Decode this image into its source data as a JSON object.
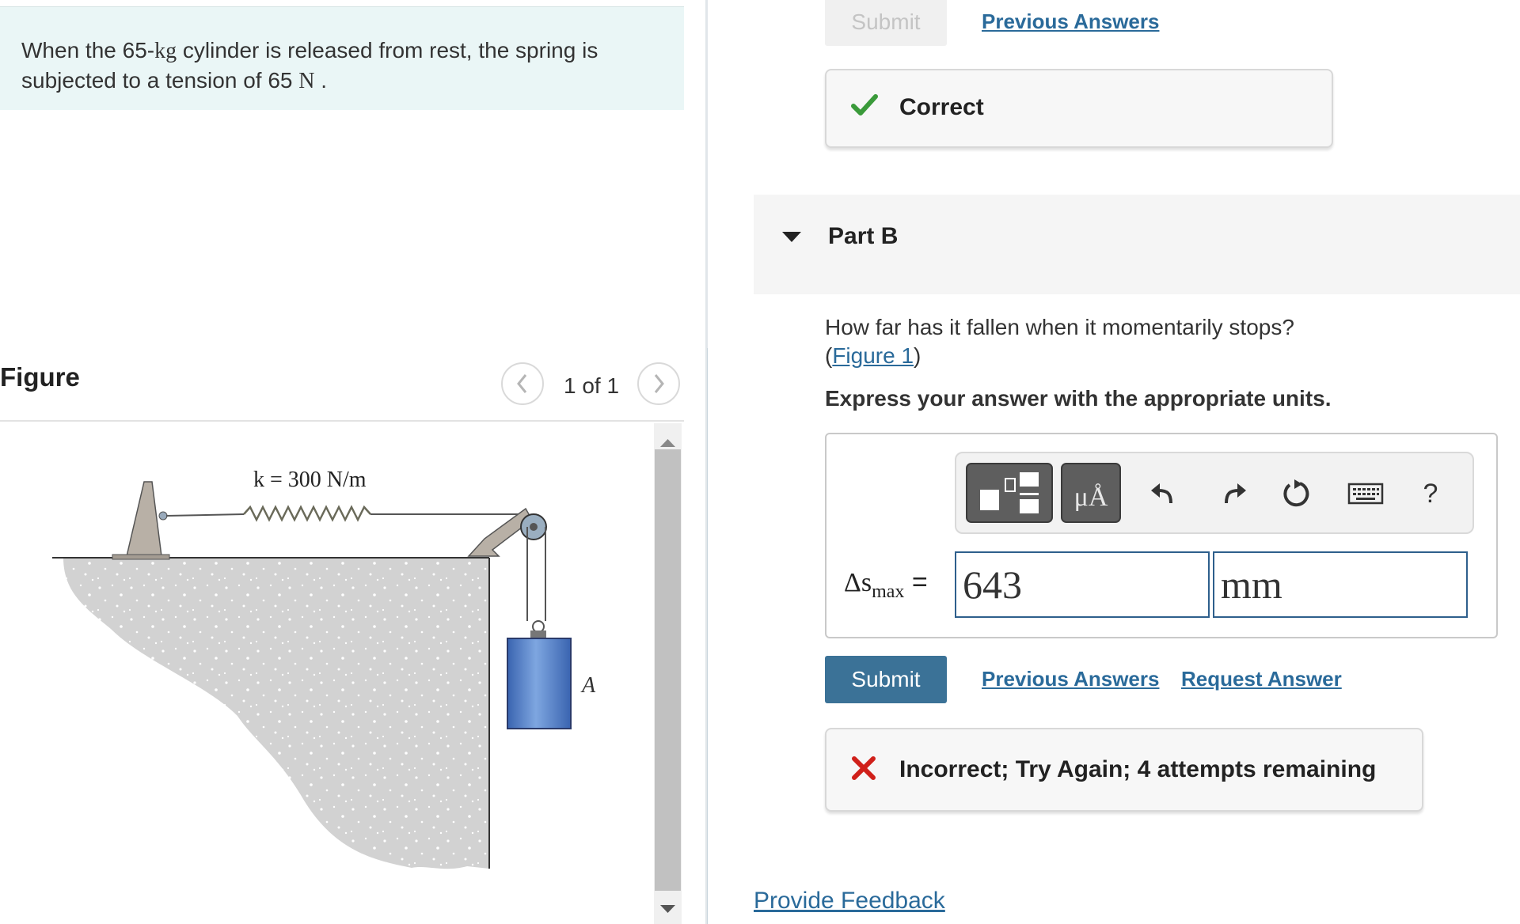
{
  "problem": {
    "text_before_mass": "When the 65-",
    "mass_unit": "kg",
    "text_middle": " cylinder is released from rest, the spring is subjected to a tension of 65 ",
    "force_unit": "N",
    "text_end": " ."
  },
  "figure_panel": {
    "title": "Figure",
    "counter": "1 of 1",
    "spring_label": "k = 300 N/m",
    "cylinder_label": "A"
  },
  "top_actions": {
    "submit_label": "Submit",
    "previous_answers_label": "Previous Answers"
  },
  "correct_feedback": {
    "label": "Correct"
  },
  "part_b": {
    "title": "Part B",
    "question_text": "How far has it fallen when it momentarily stops?",
    "figure_link_prefix": "(",
    "figure_link_text": "Figure 1",
    "figure_link_suffix": ")",
    "instruction": "Express your answer with the appropriate units."
  },
  "answer": {
    "variable_symbol": "Δs",
    "variable_subscript": "max",
    "equals": "=",
    "value": "643",
    "unit": "mm",
    "toolbar": {
      "units_button_text": "μÅ",
      "help_text": "?"
    }
  },
  "bottom_actions": {
    "submit_label": "Submit",
    "previous_answers_label": "Previous Answers",
    "request_answer_label": "Request Answer"
  },
  "incorrect_feedback": {
    "label": "Incorrect; Try Again; 4 attempts remaining"
  },
  "footer": {
    "provide_feedback_label": "Provide Feedback"
  },
  "colors": {
    "accent": "#3b7297",
    "link": "#2a6a9a",
    "correct": "#3a9a3a",
    "incorrect": "#d0201a",
    "problem_bg": "#eaf6f6",
    "cylinder": "#4a7ac8"
  }
}
